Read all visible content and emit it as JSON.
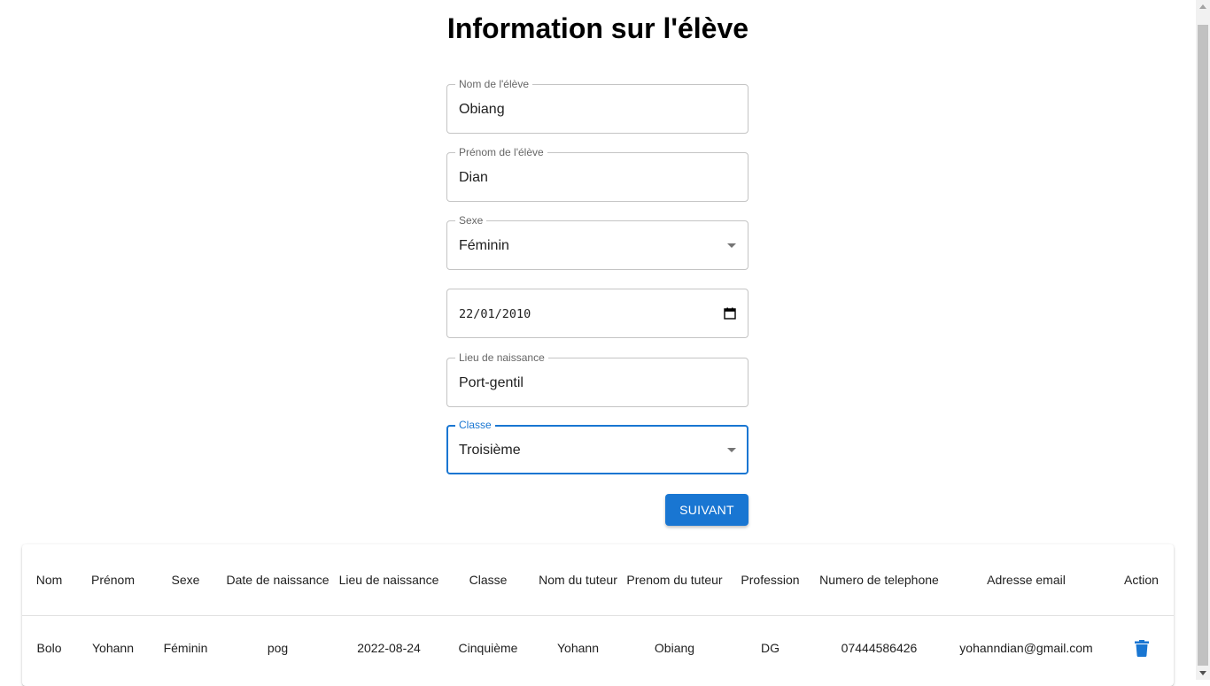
{
  "form": {
    "title": "Information sur l'élève",
    "fields": {
      "nom": {
        "label": "Nom de l'élève",
        "value": "Obiang"
      },
      "prenom": {
        "label": "Prénom de l'élève",
        "value": "Dian"
      },
      "sexe": {
        "label": "Sexe",
        "value": "Féminin"
      },
      "date_naissance": {
        "value": "22/01/2010"
      },
      "lieu": {
        "label": "Lieu de naissance",
        "value": "Port-gentil"
      },
      "classe": {
        "label": "Classe",
        "value": "Troisième"
      }
    },
    "submit_label": "SUIVANT"
  },
  "table": {
    "headers": [
      "Nom",
      "Prénom",
      "Sexe",
      "Date de naissance",
      "Lieu de naissance",
      "Classe",
      "Nom du tuteur",
      "Prenom du tuteur",
      "Profession",
      "Numero de telephone",
      "Adresse email",
      "Action"
    ],
    "rows": [
      [
        "Bolo",
        "Yohann",
        "Féminin",
        "pog",
        "2022-08-24",
        "Cinquième",
        "Yohann",
        "Obiang",
        "DG",
        "07444586426",
        "yohanndian@gmail.com"
      ]
    ]
  },
  "icons": {
    "delete": "trash-icon",
    "date": "calendar-icon",
    "select": "dropdown-arrow-icon"
  },
  "colors": {
    "primary": "#1976d2",
    "border": "#c4c4c4",
    "label": "#666666"
  }
}
